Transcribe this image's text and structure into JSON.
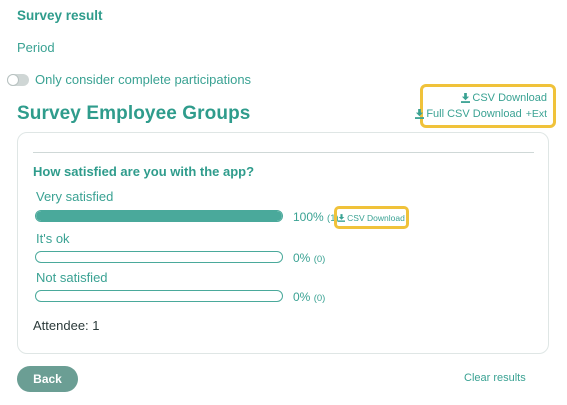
{
  "header": {
    "survey_result": "Survey result",
    "period": "Period",
    "toggle_label": "Only consider complete participations",
    "toggle_on": false
  },
  "section": {
    "title": "Survey Employee Groups",
    "csv_download": "CSV Download",
    "full_csv_download": "Full CSV Download",
    "ext": "+Ext"
  },
  "question": {
    "text": "How satisfied are you with the app?",
    "options": [
      {
        "label": "Very satisfied",
        "percent_text": "100%",
        "count_text": "(1)",
        "fill_fraction": 1.0
      },
      {
        "label": "It's ok",
        "percent_text": "0%",
        "count_text": "(0)",
        "fill_fraction": 0.0
      },
      {
        "label": "Not satisfied",
        "percent_text": "0%",
        "count_text": "(0)",
        "fill_fraction": 0.0
      }
    ],
    "option_csv_download": "CSV Download",
    "attendee": "Attendee: 1"
  },
  "footer": {
    "back": "Back",
    "clear_results": "Clear results"
  },
  "colors": {
    "accent": "#2f9c8c",
    "highlight": "#f0c23a",
    "button": "#6b9e94"
  },
  "icons": {
    "download": "download-icon"
  }
}
